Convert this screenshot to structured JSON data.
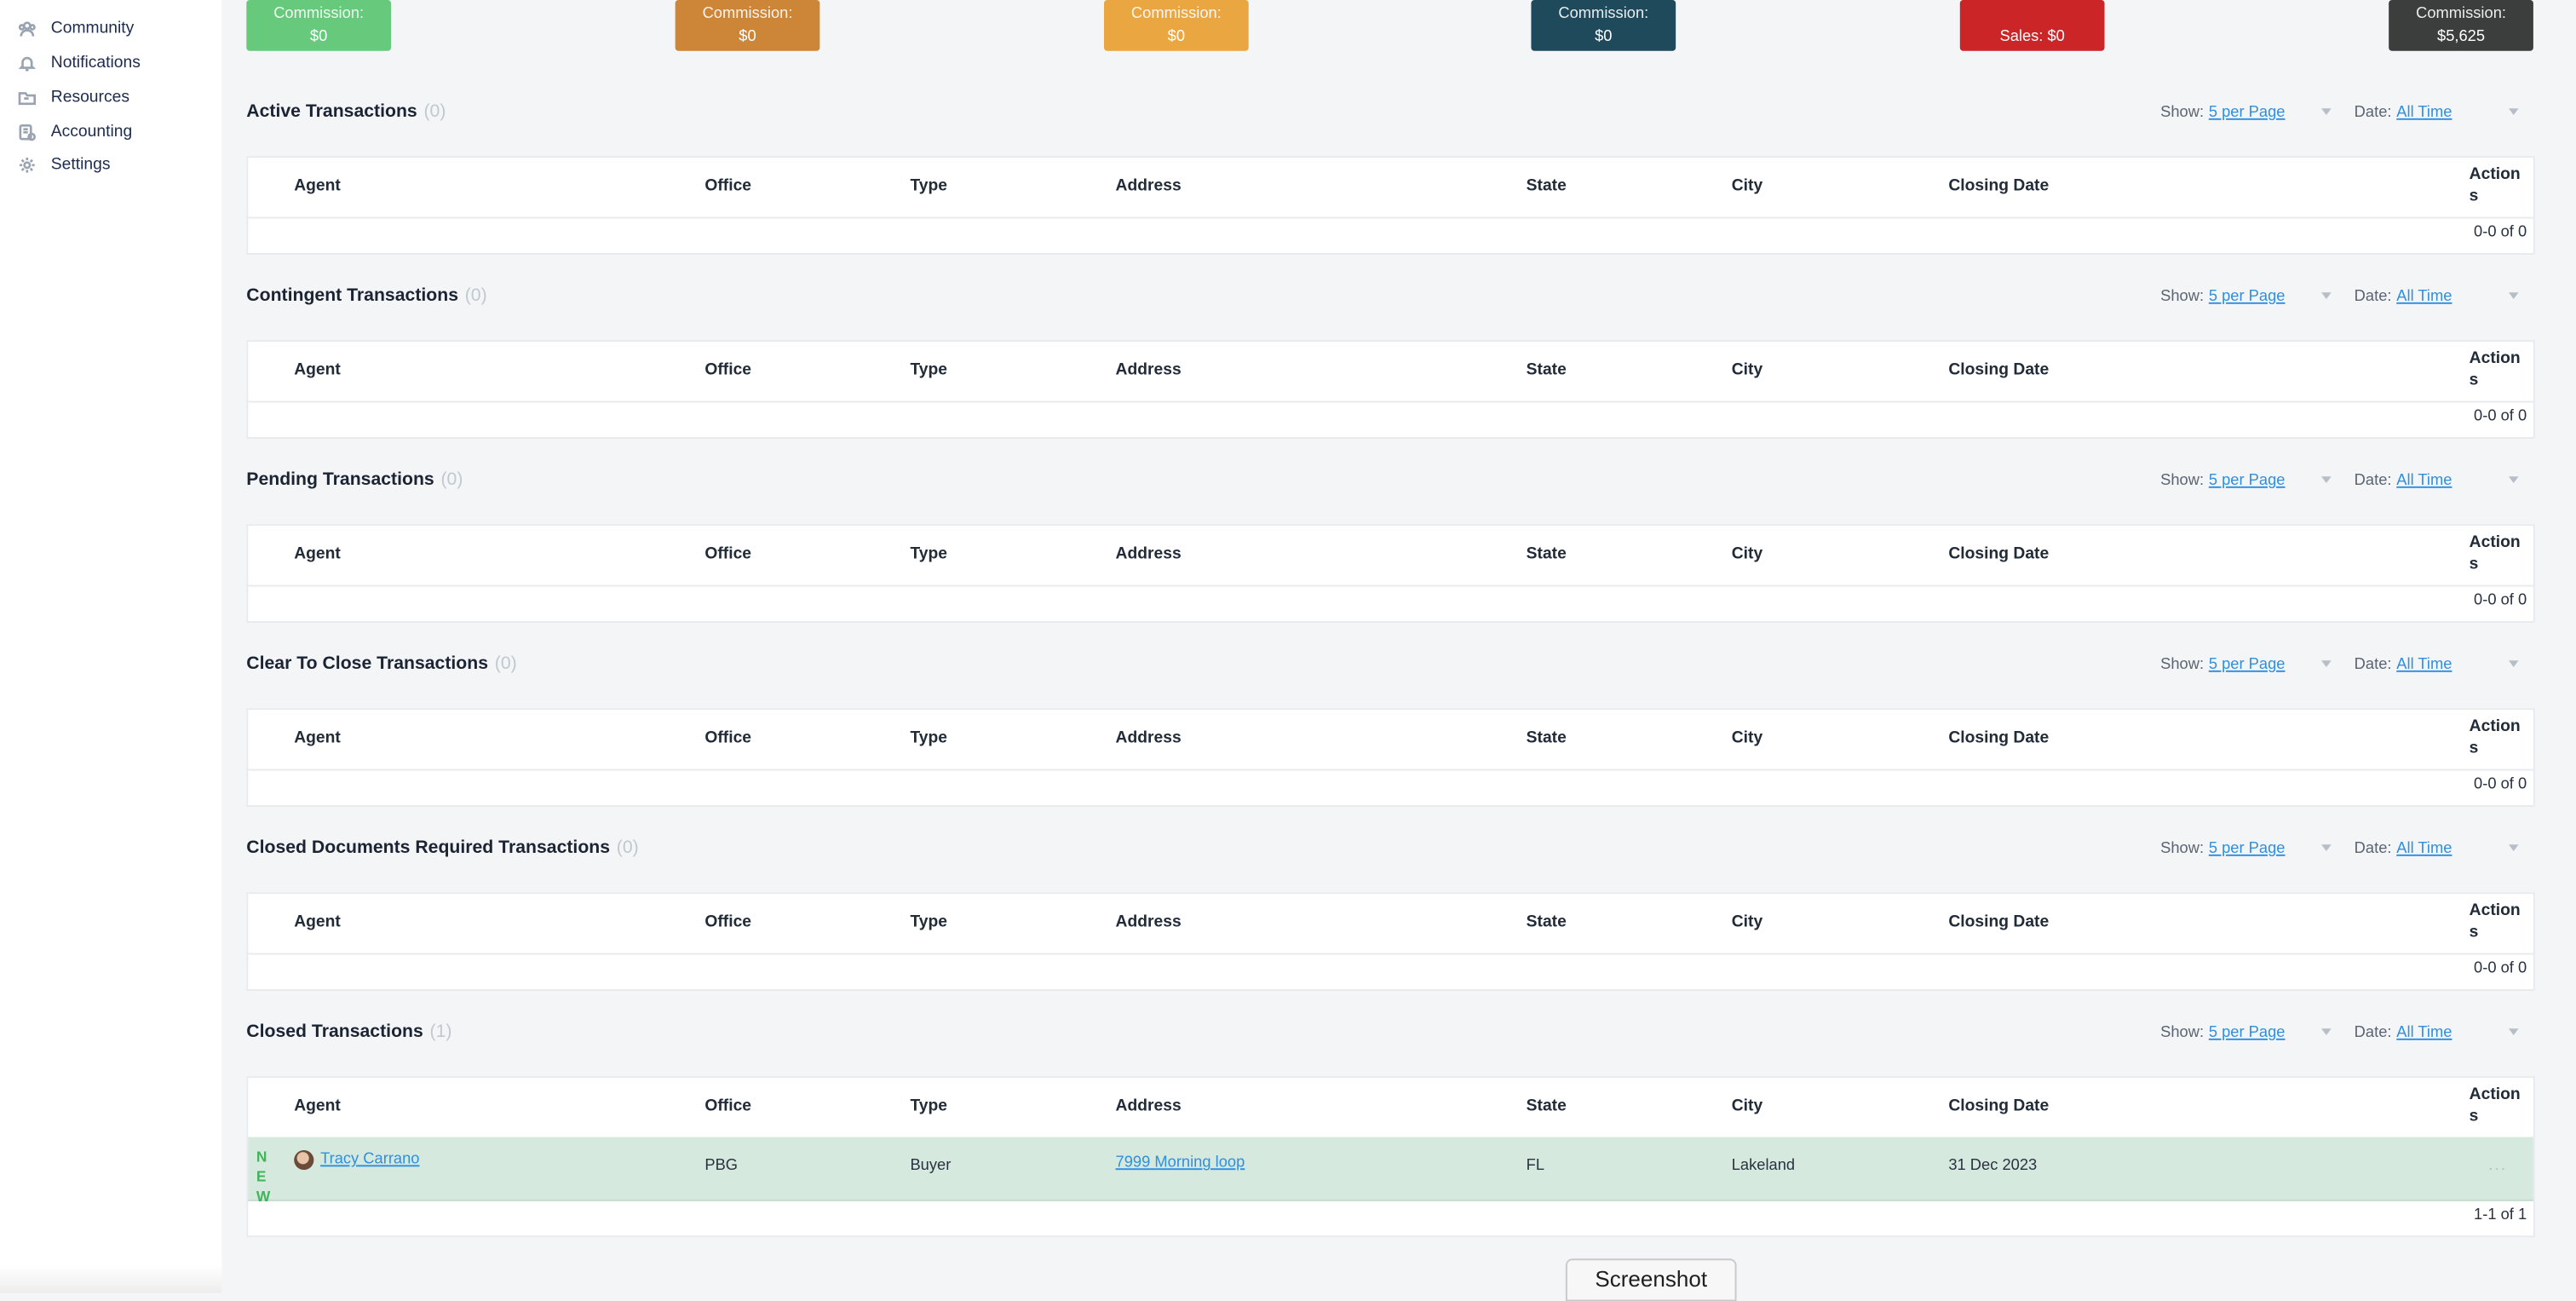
{
  "sidebar": {
    "items": [
      {
        "label": "Community",
        "icon": "community-icon"
      },
      {
        "label": "Notifications",
        "icon": "bell-icon"
      },
      {
        "label": "Resources",
        "icon": "folder-icon"
      },
      {
        "label": "Accounting",
        "icon": "accounting-icon"
      },
      {
        "label": "Settings",
        "icon": "gear-icon"
      }
    ]
  },
  "summary_cards": [
    {
      "line1": "Commission:",
      "line2": "$0",
      "color": "#67c97b"
    },
    {
      "line1": "Commission:",
      "line2": "$0",
      "color": "#cd8638"
    },
    {
      "line1": "Commission:",
      "line2": "$0",
      "color": "#eaa641"
    },
    {
      "line1": "Commission:",
      "line2": "$0",
      "color": "#1f4a5c"
    },
    {
      "line1": "",
      "line2": "Sales: $0",
      "color": "#cc2528"
    },
    {
      "line1": "Commission:",
      "line2": "$5,625",
      "color": "#3c3d3d"
    }
  ],
  "controls": {
    "show_label": "Show:",
    "show_value": "5 per Page",
    "date_label": "Date:",
    "date_value": "All Time"
  },
  "columns": [
    "Agent",
    "Office",
    "Type",
    "Address",
    "State",
    "City",
    "Closing Date",
    "Actions"
  ],
  "sections": [
    {
      "title": "Active Transactions",
      "count": "(0)",
      "pagination": "0-0 of 0"
    },
    {
      "title": "Contingent Transactions",
      "count": "(0)",
      "pagination": "0-0 of 0"
    },
    {
      "title": "Pending Transactions",
      "count": "(0)",
      "pagination": "0-0 of 0"
    },
    {
      "title": "Clear To Close Transactions",
      "count": "(0)",
      "pagination": "0-0 of 0"
    },
    {
      "title": "Closed Documents Required Transactions",
      "count": "(0)",
      "pagination": "0-0 of 0"
    },
    {
      "title": "Closed Transactions",
      "count": "(1)",
      "pagination": "1-1 of 1"
    }
  ],
  "closed_row": {
    "badge": "NEW",
    "agent": "Tracy Carrano",
    "office": "PBG",
    "type": "Buyer",
    "address": "7999 Morning loop",
    "state": "FL",
    "city": "Lakeland",
    "closing_date": "31 Dec 2023",
    "actions": "..."
  },
  "screenshot_button": "Screenshot"
}
